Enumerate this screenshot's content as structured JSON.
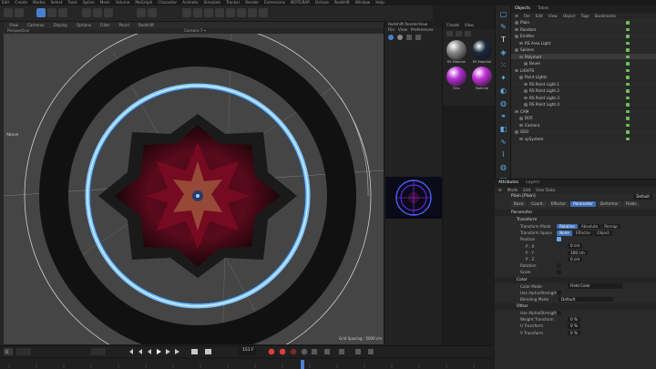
{
  "menubar": [
    "Edit",
    "Create",
    "Modes",
    "Select",
    "Tools",
    "Spline",
    "Mesh",
    "Volume",
    "MoGraph",
    "Character",
    "Animate",
    "Simulate",
    "Tracker",
    "Render",
    "Extensions",
    "MOTGRAP",
    "Octane",
    "Redshift",
    "Window",
    "Help"
  ],
  "viewport": {
    "menu": [
      "View",
      "Cameras",
      "Display",
      "Options",
      "Filter",
      "Panel",
      "Redshift"
    ],
    "label": "Perspective",
    "camera": "Camera 7→",
    "side_label": "Above",
    "grid_spacing": "Grid Spacing : 5000 cm"
  },
  "timeline": {
    "frame": "151 F"
  },
  "redshift": {
    "title": "Redshift RenderView",
    "menu": [
      "File",
      "View",
      "Preferences"
    ]
  },
  "materials": {
    "menu": [
      "Create",
      "View"
    ],
    "items": [
      {
        "label": "RS Material",
        "color": "#8a8a8a"
      },
      {
        "label": "RS Material",
        "color": "#1a2a3c"
      },
      {
        "label": "Disc",
        "color": "#b52ed4"
      },
      {
        "label": "Material",
        "color": "#c431d6"
      }
    ]
  },
  "objects": {
    "tabs": [
      "Objects",
      "Takes"
    ],
    "menu": [
      "☰",
      "File",
      "Edit",
      "View",
      "Object",
      "Tags",
      "Bookmarks"
    ],
    "rows": [
      {
        "label": "Plain",
        "indent": 0
      },
      {
        "label": "Random",
        "indent": 0
      },
      {
        "label": "Emitter",
        "indent": 0
      },
      {
        "label": "RS Area Light",
        "indent": 1
      },
      {
        "label": "Splines",
        "indent": 0
      },
      {
        "label": "Polymod",
        "indent": 1
      },
      {
        "label": "Bevel",
        "indent": 2
      },
      {
        "label": "LIGHTS",
        "indent": 0
      },
      {
        "label": "Point Lights",
        "indent": 1
      },
      {
        "label": "RS Point Light.1",
        "indent": 2
      },
      {
        "label": "RS Point Light.2",
        "indent": 2
      },
      {
        "label": "RS Point Light.3",
        "indent": 2
      },
      {
        "label": "RS Point Light.4",
        "indent": 2
      },
      {
        "label": "CAM",
        "indent": 0
      },
      {
        "label": "DOF",
        "indent": 1
      },
      {
        "label": "Camera",
        "indent": 1
      },
      {
        "label": "GEO",
        "indent": 0
      },
      {
        "label": "spSystem",
        "indent": 1
      }
    ]
  },
  "attributes": {
    "tabs": [
      "Attributes",
      "Layers"
    ],
    "menu": [
      "☰",
      "Mode",
      "Edit",
      "User Data"
    ],
    "object_name": "Plain [Plain]",
    "default_label": "Default",
    "page_tabs": [
      "Basic",
      "Coord.",
      "Effector",
      "Parameter",
      "Deformer",
      "Fields"
    ],
    "active_tab": "Parameter",
    "section_parameter": "Parameter",
    "group_transform": "Transform",
    "transform_mode_label": "Transform Mode",
    "transform_mode": [
      "Relative",
      "Absolute",
      "Remap"
    ],
    "transform_space_label": "Transform Space",
    "transform_space": [
      "Node",
      "Effector",
      "Object"
    ],
    "position_label": "Position",
    "px_label": "P . X",
    "px": "0 cm",
    "py_label": "P . Y",
    "py": "100 cm",
    "pz_label": "P . Z",
    "pz": "0 cm",
    "rotation_label": "Rotation",
    "scale_label": "Scale",
    "group_color": "Color",
    "color_mode_label": "Color Mode",
    "color_mode": "Field Color",
    "alpha_label": "Use Alpha/Strength",
    "blend_label": "Blending Mode",
    "blend": "Default",
    "group_other": "Other",
    "alpha2_label": "Use Alpha/Strength",
    "weight_label": "Weight Transform",
    "weight": "0 %",
    "utrans_label": "U Transform",
    "utrans": "0 %",
    "vtrans_label": "V Transform",
    "vtrans": "0 %"
  }
}
